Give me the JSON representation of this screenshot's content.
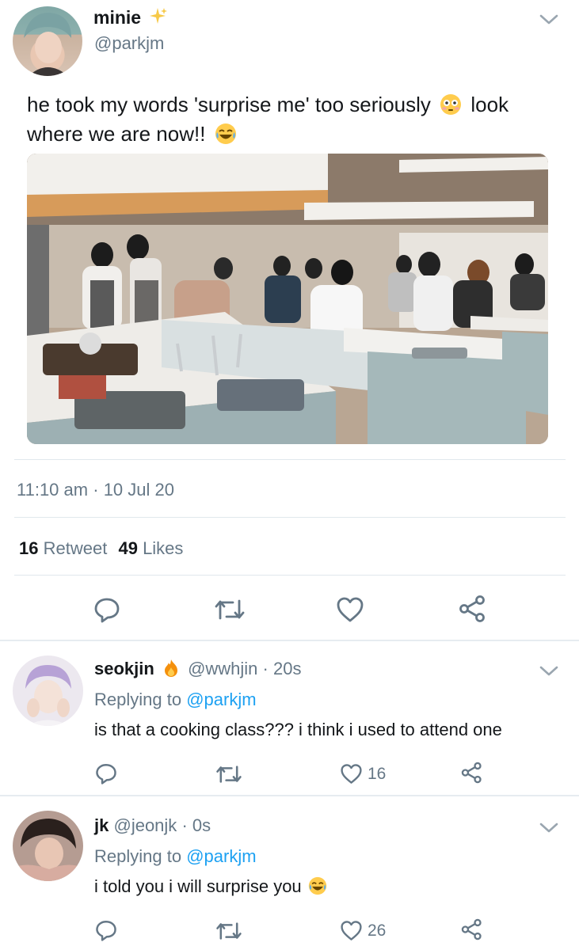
{
  "main_tweet": {
    "display_name": "minie",
    "handle": "@parkjm",
    "text": "he took my words 'surprise me' too seriously",
    "text_tail": "look",
    "text_line2": "where we are now!!",
    "time": "11:10 am",
    "date_sep": "·",
    "date": "10 Jul 20",
    "retweet_count": "16",
    "retweet_label": "Retweet",
    "like_count": "49",
    "like_label": "Likes"
  },
  "replies": [
    {
      "display_name": "seokjin",
      "handle": "@wwhjin",
      "time": "· 20s",
      "replying_label": "Replying to",
      "replying_to": "@parkjm",
      "text": "is that a cooking class??? i think i used to attend one",
      "like_count": "16"
    },
    {
      "display_name": "jk",
      "handle": "@jeonjk",
      "time": "· 0s",
      "replying_label": "Replying to",
      "replying_to": "@parkjm",
      "text": "i told you i will surprise you",
      "like_count": "26"
    }
  ],
  "colors": {
    "accent": "#1da1f2",
    "muted": "#657786",
    "divider": "#e1e8ed"
  },
  "icons": [
    "sparkles-icon",
    "flushed-emoji-icon",
    "laughing-emoji-icon",
    "fire-emoji-icon",
    "reply-icon",
    "retweet-icon",
    "heart-icon",
    "share-icon",
    "chevron-down-icon"
  ]
}
